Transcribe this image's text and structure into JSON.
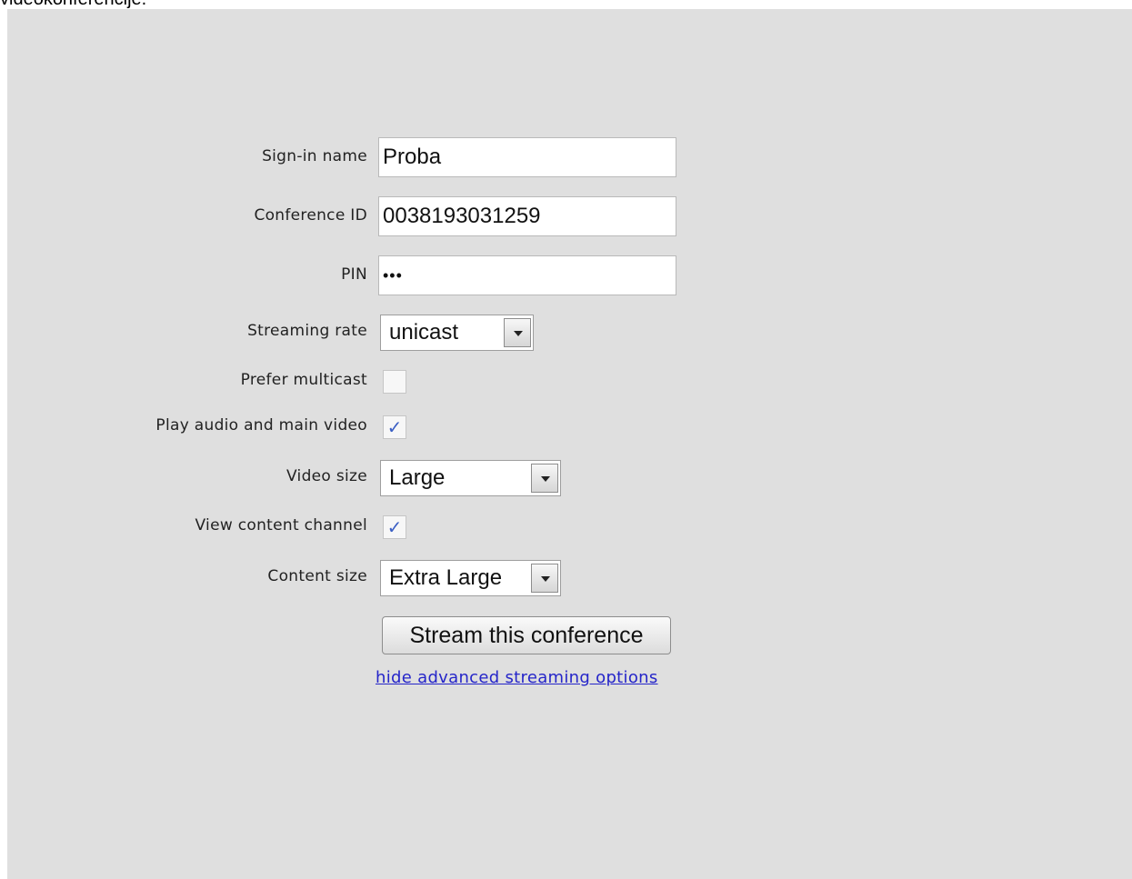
{
  "caption": "videokonferencije.",
  "form": {
    "sign_in_name": {
      "label": "Sign-in name",
      "value": "Proba"
    },
    "conference_id": {
      "label": "Conference ID",
      "value": "0038193031259"
    },
    "pin": {
      "label": "PIN",
      "value": "•••"
    },
    "streaming_rate": {
      "label": "Streaming rate",
      "value": "unicast"
    },
    "prefer_multicast": {
      "label": "Prefer multicast",
      "checked": false,
      "mark": ""
    },
    "play_audio_main_video": {
      "label": "Play audio and main video",
      "checked": true,
      "mark": "✓"
    },
    "video_size": {
      "label": "Video size",
      "value": "Large"
    },
    "view_content_channel": {
      "label": "View content channel",
      "checked": true,
      "mark": "✓"
    },
    "content_size": {
      "label": "Content size",
      "value": "Extra Large"
    },
    "submit_label": "Stream this conference",
    "toggle_link": "hide advanced streaming options"
  },
  "colors": {
    "panel_bg": "#dfdfdf",
    "link": "#2525c9",
    "check": "#3b5fc4"
  }
}
